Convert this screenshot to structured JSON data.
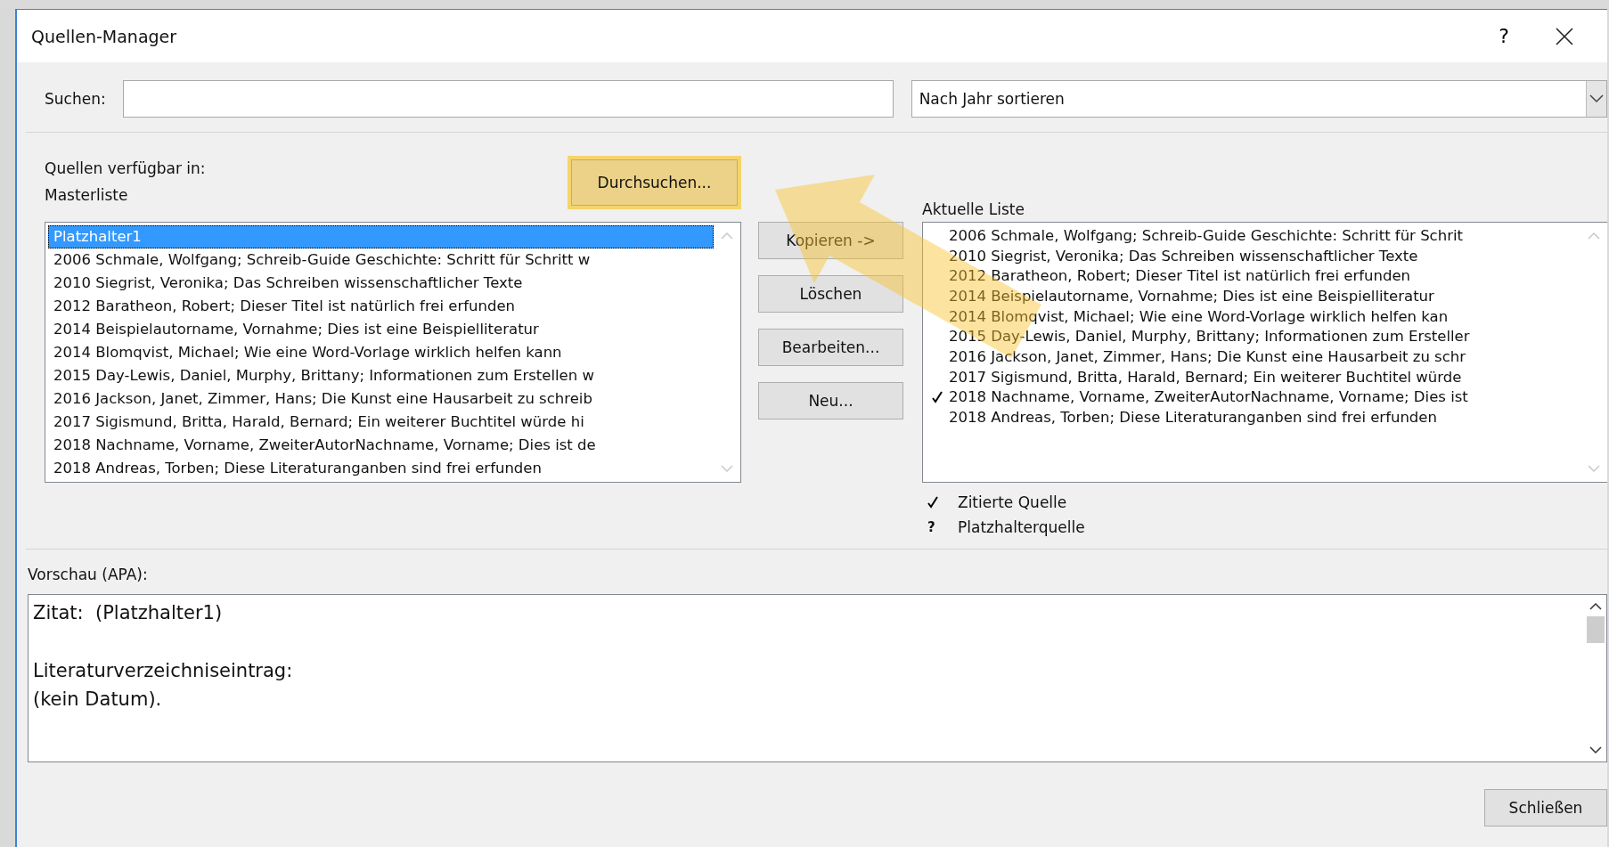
{
  "window": {
    "title": "Quellen-Manager",
    "help_button": "?"
  },
  "search": {
    "label": "Suchen:"
  },
  "sort": {
    "value": "Nach Jahr sortieren"
  },
  "sources_label": "Quellen verfügbar in:",
  "browse_button": {
    "label": "Durchsuchen...",
    "highlighted": true
  },
  "master_list": {
    "label": "Masterliste",
    "items": [
      {
        "text": "Platzhalter1",
        "selected": true
      },
      {
        "text": "2006 Schmale, Wolfgang; Schreib-Guide Geschichte: Schritt für Schritt w",
        "selected": false
      },
      {
        "text": "2010 Siegrist, Veronika; Das Schreiben wissenschaftlicher Texte",
        "selected": false
      },
      {
        "text": "2012 Baratheon, Robert; Dieser Titel ist natürlich frei erfunden",
        "selected": false
      },
      {
        "text": "2014 Beispielautorname, Vornahme; Dies ist eine Beispielliteratur",
        "selected": false
      },
      {
        "text": "2014 Blomqvist, Michael; Wie eine Word-Vorlage wirklich helfen kann",
        "selected": false
      },
      {
        "text": "2015 Day-Lewis, Daniel, Murphy, Brittany; Informationen zum Erstellen w",
        "selected": false
      },
      {
        "text": "2016 Jackson, Janet, Zimmer, Hans; Die Kunst eine Hausarbeit zu schreib",
        "selected": false
      },
      {
        "text": "2017 Sigismund, Britta, Harald, Bernard; Ein weiterer Buchtitel würde hi",
        "selected": false
      },
      {
        "text": "2018 Nachname, Vorname, ZweiterAutorNachname, Vorname; Dies ist de",
        "selected": false
      },
      {
        "text": "2018 Andreas, Torben; Diese Literaturanganben sind frei erfunden",
        "selected": false
      }
    ]
  },
  "actions": [
    {
      "label": "Kopieren ->"
    },
    {
      "label": "Löschen"
    },
    {
      "label": "Bearbeiten..."
    },
    {
      "label": "Neu..."
    }
  ],
  "current_list": {
    "label": "Aktuelle Liste",
    "items": [
      {
        "text": "2006 Schmale, Wolfgang; Schreib-Guide Geschichte: Schritt für Schrit",
        "cited": false
      },
      {
        "text": "2010 Siegrist, Veronika; Das Schreiben wissenschaftlicher Texte",
        "cited": false
      },
      {
        "text": "2012 Baratheon, Robert; Dieser Titel ist natürlich frei erfunden",
        "cited": false
      },
      {
        "text": "2014 Beispielautorname, Vornahme; Dies ist eine Beispielliteratur",
        "cited": false
      },
      {
        "text": "2014 Blomqvist, Michael; Wie eine Word-Vorlage wirklich helfen kan",
        "cited": false
      },
      {
        "text": "2015 Day-Lewis, Daniel, Murphy, Brittany; Informationen zum Ersteller",
        "cited": false
      },
      {
        "text": "2016 Jackson, Janet, Zimmer, Hans; Die Kunst eine Hausarbeit zu schr",
        "cited": false
      },
      {
        "text": "2017 Sigismund, Britta, Harald, Bernard; Ein weiterer Buchtitel würde",
        "cited": false
      },
      {
        "text": "2018 Nachname, Vorname, ZweiterAutorNachname, Vorname; Dies ist",
        "cited": true
      },
      {
        "text": "2018 Andreas, Torben; Diese Literaturanganben sind frei erfunden",
        "cited": false
      }
    ]
  },
  "legend": [
    {
      "kind": "cited",
      "label": "Zitierte Quelle"
    },
    {
      "kind": "placeholder",
      "symbol": "?",
      "label": "Platzhalterquelle"
    }
  ],
  "preview": {
    "label": "Vorschau (APA):",
    "paragraphs": [
      {
        "lines": [
          "Zitat:  (Platzhalter1)"
        ]
      },
      {
        "lines": [
          "Literaturverzeichniseintrag:",
          "(kein Datum)."
        ]
      }
    ]
  },
  "close_button": "Schließen",
  "annotation": {
    "kind": "arrow"
  }
}
